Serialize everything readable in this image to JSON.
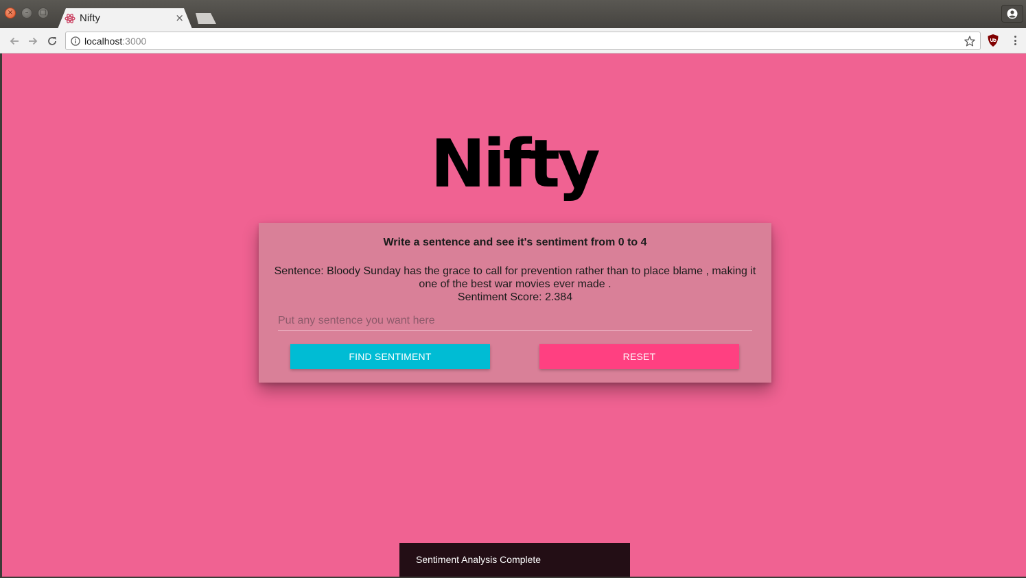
{
  "browser": {
    "tab": {
      "title": "Nifty",
      "favicon": "react-logo-icon",
      "close_glyph": "×"
    },
    "address": {
      "host": "localhost",
      "port": ":3000"
    }
  },
  "app": {
    "title": "Nifty",
    "background_color": "#f06292",
    "card": {
      "heading": "Write a sentence and see it's sentiment from 0 to 4",
      "sentence_line": "Sentence: Bloody Sunday has the grace to call for prevention rather than to place blame , making it one of the best war movies ever made .",
      "score_line": "Sentiment Score: 2.384"
    },
    "input": {
      "value": "",
      "placeholder": "Put any sentence you want here"
    },
    "buttons": {
      "find_label": "Find Sentiment",
      "find_color": "#00bcd4",
      "reset_label": "Reset",
      "reset_color": "#ff4081"
    },
    "snackbar": {
      "message": "Sentiment Analysis Complete"
    }
  }
}
